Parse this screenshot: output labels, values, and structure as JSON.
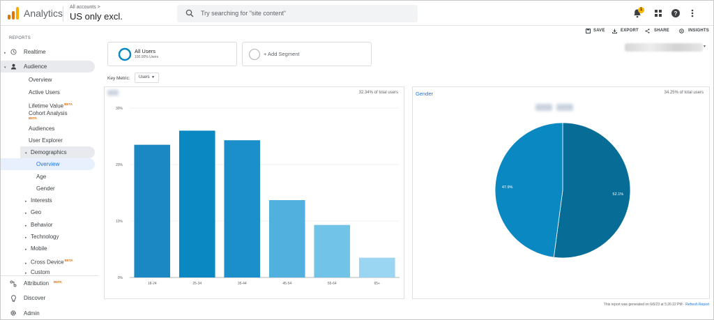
{
  "header": {
    "app_name": "Analytics",
    "account_path": "All accounts >",
    "property_name": "US only excl.",
    "search_placeholder": "Try searching for \"site content\"",
    "notification_count": "1",
    "logo_colors": [
      "#f9ab00",
      "#e37400",
      "#e37400"
    ]
  },
  "sidebar": {
    "reports_label": "REPORTS",
    "realtime": "Realtime",
    "audience": "Audience",
    "sub_items": {
      "overview": "Overview",
      "active_users": "Active Users",
      "lifetime_value": "Lifetime Value",
      "cohort_analysis": "Cohort Analysis",
      "audiences": "Audiences",
      "user_explorer": "User Explorer",
      "demographics": "Demographics",
      "demo_overview": "Overview",
      "demo_age": "Age",
      "demo_gender": "Gender",
      "interests": "Interests",
      "geo": "Geo",
      "behavior": "Behavior",
      "technology": "Technology",
      "mobile": "Mobile",
      "cross_device": "Cross Device",
      "custom": "Custom"
    },
    "beta": "BETA",
    "attribution": "Attribution",
    "discover": "Discover",
    "admin": "Admin"
  },
  "toolbar": {
    "save": "SAVE",
    "export": "EXPORT",
    "share": "SHARE",
    "insights": "INSIGHTS"
  },
  "segments": {
    "all_users": "All Users",
    "all_users_pct": "100.00% Users",
    "add_segment": "+ Add Segment"
  },
  "key_metric": {
    "label": "Key Metric:",
    "value": "Users"
  },
  "age_panel": {
    "pct_total": "32.34% of total users"
  },
  "gender_panel": {
    "title": "Gender",
    "pct_total": "34.25% of total users"
  },
  "footer": {
    "generated": "This report was generated on 6/6/23 at 5:26:22 PM - ",
    "refresh": "Refresh Report"
  },
  "chart_data": [
    {
      "type": "bar",
      "categories": [
        "18-24",
        "25-34",
        "35-44",
        "45-54",
        "55-64",
        "65+"
      ],
      "values": [
        23.5,
        26,
        24.3,
        13.7,
        9.3,
        3.5
      ],
      "colors": [
        "#1b88c4",
        "#0a88c2",
        "#1b8fc9",
        "#52b0de",
        "#72c3e8",
        "#9ad6f2"
      ],
      "y_ticks": [
        "0%",
        "10%",
        "20%",
        "30%"
      ],
      "ylim": [
        0,
        30
      ]
    },
    {
      "type": "pie",
      "labels": [
        "47.9%",
        "52.1%"
      ],
      "values": [
        47.9,
        52.1
      ],
      "colors": [
        "#0a88c2",
        "#076c96"
      ]
    }
  ]
}
